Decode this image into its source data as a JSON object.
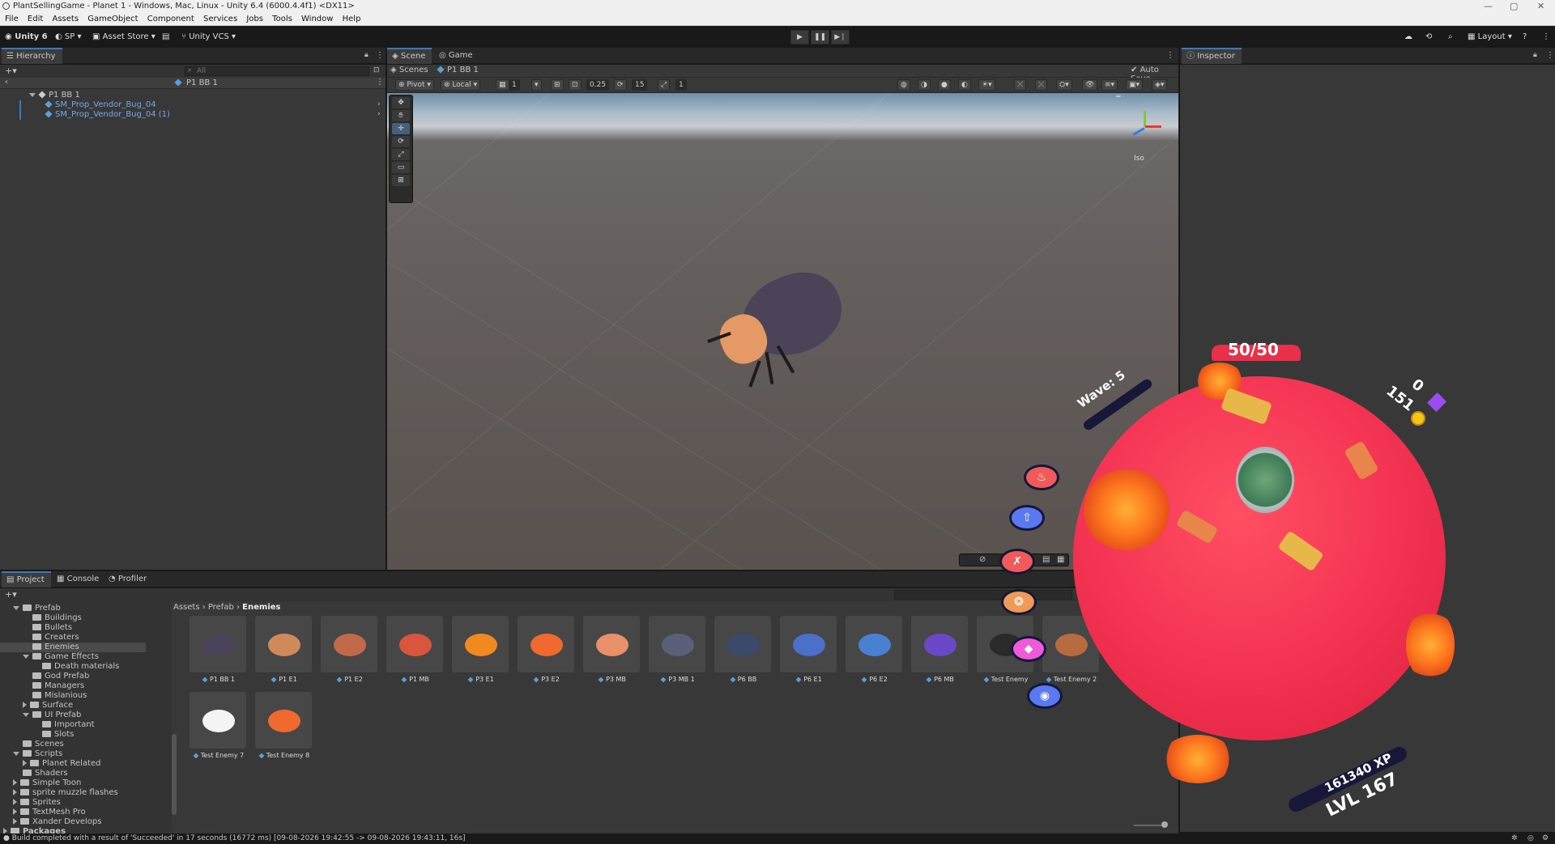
{
  "window": {
    "title": "PlantSellingGame - Planet 1 - Windows, Mac, Linux - Unity 6.4 (6000.4.4f1) <DX11>",
    "controls": [
      "—",
      "▢",
      "✕"
    ]
  },
  "menu": [
    "File",
    "Edit",
    "Assets",
    "GameObject",
    "Component",
    "Services",
    "Jobs",
    "Tools",
    "Window",
    "Help"
  ],
  "toolbar": {
    "unity_label": "Unity 6",
    "account_label": "SP",
    "asset_store_label": "Asset Store",
    "vcs_label": "Unity VCS",
    "layout_label": "Layout"
  },
  "hierarchy": {
    "tab": "Hierarchy",
    "search_placeholder": "All",
    "breadcrumb": "P1 BB 1",
    "items": [
      {
        "label": "P1 BB 1"
      },
      {
        "label": "SM_Prop_Vendor_Bug_04"
      },
      {
        "label": "SM_Prop_Vendor_Bug_04 (1)"
      }
    ]
  },
  "scene": {
    "tabs": [
      "Scene",
      "Game"
    ],
    "breadcrumb_root": "Scenes",
    "breadcrumb_item": "P1 BB 1",
    "auto_save": "Auto Save",
    "pivot": "Pivot",
    "local": "Local",
    "grid_val": "1",
    "snap_val": "0.25",
    "rot_val": "15",
    "scale_val": "1",
    "iso": "Iso",
    "tools": [
      "✥",
      "✛",
      "⟳",
      "⤢",
      "▭",
      "⊞"
    ]
  },
  "inspector": {
    "tab": "Inspector"
  },
  "project": {
    "tabs": [
      "Project",
      "Console",
      "Profiler"
    ],
    "tree": [
      {
        "label": "Prefab",
        "indent": 1,
        "arrow": "down"
      },
      {
        "label": "Buildings",
        "indent": 2
      },
      {
        "label": "Bullets",
        "indent": 2
      },
      {
        "label": "Creaters",
        "indent": 2
      },
      {
        "label": "Enemies",
        "indent": 2
      },
      {
        "label": "Game Effects",
        "indent": 2,
        "arrow": "down"
      },
      {
        "label": "Death materials",
        "indent": 3
      },
      {
        "label": "God Prefab",
        "indent": 2
      },
      {
        "label": "Managers",
        "indent": 2
      },
      {
        "label": "Mislanious",
        "indent": 2
      },
      {
        "label": "Surface",
        "indent": 2,
        "arrow": "right"
      },
      {
        "label": "UI Prefab",
        "indent": 2,
        "arrow": "down"
      },
      {
        "label": "Important",
        "indent": 3
      },
      {
        "label": "Slots",
        "indent": 3
      },
      {
        "label": "Scenes",
        "indent": 1
      },
      {
        "label": "Scripts",
        "indent": 1,
        "arrow": "down"
      },
      {
        "label": "Planet Related",
        "indent": 2,
        "arrow": "right"
      },
      {
        "label": "Shaders",
        "indent": 1
      },
      {
        "label": "Simple Toon",
        "indent": 1,
        "arrow": "right"
      },
      {
        "label": "sprite muzzle flashes",
        "indent": 1,
        "arrow": "right"
      },
      {
        "label": "Sprites",
        "indent": 1,
        "arrow": "right"
      },
      {
        "label": "TextMesh Pro",
        "indent": 1,
        "arrow": "right"
      },
      {
        "label": "Xander Develops",
        "indent": 1,
        "arrow": "right"
      },
      {
        "label": "Packages",
        "indent": 0,
        "arrow": "right"
      }
    ],
    "breadcrumb": [
      "Assets",
      "Prefab",
      "Enemies"
    ],
    "assets": [
      {
        "label": "P1 BB 1",
        "color": "#4a4258"
      },
      {
        "label": "P1 E1",
        "color": "#d08a5a"
      },
      {
        "label": "P1 E2",
        "color": "#c06a4a"
      },
      {
        "label": "P1 MB",
        "color": "#d8553e"
      },
      {
        "label": "P3 E1",
        "color": "#f08a20"
      },
      {
        "label": "P3 E2",
        "color": "#f06a30"
      },
      {
        "label": "P3 MB",
        "color": "#e8906a"
      },
      {
        "label": "P3 MB 1",
        "color": "#5a607a"
      },
      {
        "label": "P6 BB",
        "color": "#3a4a6a"
      },
      {
        "label": "P6 E1",
        "color": "#4a70c8"
      },
      {
        "label": "P6 E2",
        "color": "#4a80d0"
      },
      {
        "label": "P6 MB",
        "color": "#6a48c8"
      },
      {
        "label": "Test Enemy",
        "color": "#2a2a2a"
      },
      {
        "label": "Test Enemy 2",
        "color": "#b86a40"
      },
      {
        "label": "Test Enemy 7",
        "color": "#f4f4f4"
      },
      {
        "label": "Test Enemy 8",
        "color": "#f06a30"
      }
    ]
  },
  "game_hud": {
    "health": "50/50",
    "wave": "Wave:  5",
    "coins": "151",
    "gems": "0",
    "xp": "161340 XP",
    "level": "LVL 167"
  },
  "status": {
    "message": "Build completed with a result of 'Succeeded' in 17 seconds (16772 ms) [09-08-2026 19:42:55 -> 09-08-2026 19:43:11, 16s]"
  },
  "colors": {
    "accent": "#3a79bb",
    "planet": "#f53755",
    "panel": "#383838",
    "header": "#282828"
  }
}
